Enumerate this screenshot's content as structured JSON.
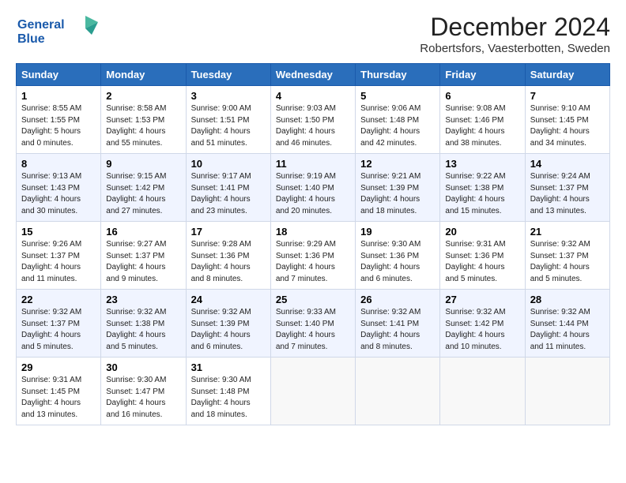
{
  "header": {
    "logo_line1": "General",
    "logo_line2": "Blue",
    "title": "December 2024",
    "subtitle": "Robertsfors, Vaesterbotten, Sweden"
  },
  "calendar": {
    "days_of_week": [
      "Sunday",
      "Monday",
      "Tuesday",
      "Wednesday",
      "Thursday",
      "Friday",
      "Saturday"
    ],
    "weeks": [
      [
        {
          "day": "1",
          "sunrise": "8:55 AM",
          "sunset": "1:55 PM",
          "daylight": "5 hours and 0 minutes."
        },
        {
          "day": "2",
          "sunrise": "8:58 AM",
          "sunset": "1:53 PM",
          "daylight": "4 hours and 55 minutes."
        },
        {
          "day": "3",
          "sunrise": "9:00 AM",
          "sunset": "1:51 PM",
          "daylight": "4 hours and 51 minutes."
        },
        {
          "day": "4",
          "sunrise": "9:03 AM",
          "sunset": "1:50 PM",
          "daylight": "4 hours and 46 minutes."
        },
        {
          "day": "5",
          "sunrise": "9:06 AM",
          "sunset": "1:48 PM",
          "daylight": "4 hours and 42 minutes."
        },
        {
          "day": "6",
          "sunrise": "9:08 AM",
          "sunset": "1:46 PM",
          "daylight": "4 hours and 38 minutes."
        },
        {
          "day": "7",
          "sunrise": "9:10 AM",
          "sunset": "1:45 PM",
          "daylight": "4 hours and 34 minutes."
        }
      ],
      [
        {
          "day": "8",
          "sunrise": "9:13 AM",
          "sunset": "1:43 PM",
          "daylight": "4 hours and 30 minutes."
        },
        {
          "day": "9",
          "sunrise": "9:15 AM",
          "sunset": "1:42 PM",
          "daylight": "4 hours and 27 minutes."
        },
        {
          "day": "10",
          "sunrise": "9:17 AM",
          "sunset": "1:41 PM",
          "daylight": "4 hours and 23 minutes."
        },
        {
          "day": "11",
          "sunrise": "9:19 AM",
          "sunset": "1:40 PM",
          "daylight": "4 hours and 20 minutes."
        },
        {
          "day": "12",
          "sunrise": "9:21 AM",
          "sunset": "1:39 PM",
          "daylight": "4 hours and 18 minutes."
        },
        {
          "day": "13",
          "sunrise": "9:22 AM",
          "sunset": "1:38 PM",
          "daylight": "4 hours and 15 minutes."
        },
        {
          "day": "14",
          "sunrise": "9:24 AM",
          "sunset": "1:37 PM",
          "daylight": "4 hours and 13 minutes."
        }
      ],
      [
        {
          "day": "15",
          "sunrise": "9:26 AM",
          "sunset": "1:37 PM",
          "daylight": "4 hours and 11 minutes."
        },
        {
          "day": "16",
          "sunrise": "9:27 AM",
          "sunset": "1:37 PM",
          "daylight": "4 hours and 9 minutes."
        },
        {
          "day": "17",
          "sunrise": "9:28 AM",
          "sunset": "1:36 PM",
          "daylight": "4 hours and 8 minutes."
        },
        {
          "day": "18",
          "sunrise": "9:29 AM",
          "sunset": "1:36 PM",
          "daylight": "4 hours and 7 minutes."
        },
        {
          "day": "19",
          "sunrise": "9:30 AM",
          "sunset": "1:36 PM",
          "daylight": "4 hours and 6 minutes."
        },
        {
          "day": "20",
          "sunrise": "9:31 AM",
          "sunset": "1:36 PM",
          "daylight": "4 hours and 5 minutes."
        },
        {
          "day": "21",
          "sunrise": "9:32 AM",
          "sunset": "1:37 PM",
          "daylight": "4 hours and 5 minutes."
        }
      ],
      [
        {
          "day": "22",
          "sunrise": "9:32 AM",
          "sunset": "1:37 PM",
          "daylight": "4 hours and 5 minutes."
        },
        {
          "day": "23",
          "sunrise": "9:32 AM",
          "sunset": "1:38 PM",
          "daylight": "4 hours and 5 minutes."
        },
        {
          "day": "24",
          "sunrise": "9:32 AM",
          "sunset": "1:39 PM",
          "daylight": "4 hours and 6 minutes."
        },
        {
          "day": "25",
          "sunrise": "9:33 AM",
          "sunset": "1:40 PM",
          "daylight": "4 hours and 7 minutes."
        },
        {
          "day": "26",
          "sunrise": "9:32 AM",
          "sunset": "1:41 PM",
          "daylight": "4 hours and 8 minutes."
        },
        {
          "day": "27",
          "sunrise": "9:32 AM",
          "sunset": "1:42 PM",
          "daylight": "4 hours and 10 minutes."
        },
        {
          "day": "28",
          "sunrise": "9:32 AM",
          "sunset": "1:44 PM",
          "daylight": "4 hours and 11 minutes."
        }
      ],
      [
        {
          "day": "29",
          "sunrise": "9:31 AM",
          "sunset": "1:45 PM",
          "daylight": "4 hours and 13 minutes."
        },
        {
          "day": "30",
          "sunrise": "9:30 AM",
          "sunset": "1:47 PM",
          "daylight": "4 hours and 16 minutes."
        },
        {
          "day": "31",
          "sunrise": "9:30 AM",
          "sunset": "1:48 PM",
          "daylight": "4 hours and 18 minutes."
        },
        null,
        null,
        null,
        null
      ]
    ]
  }
}
